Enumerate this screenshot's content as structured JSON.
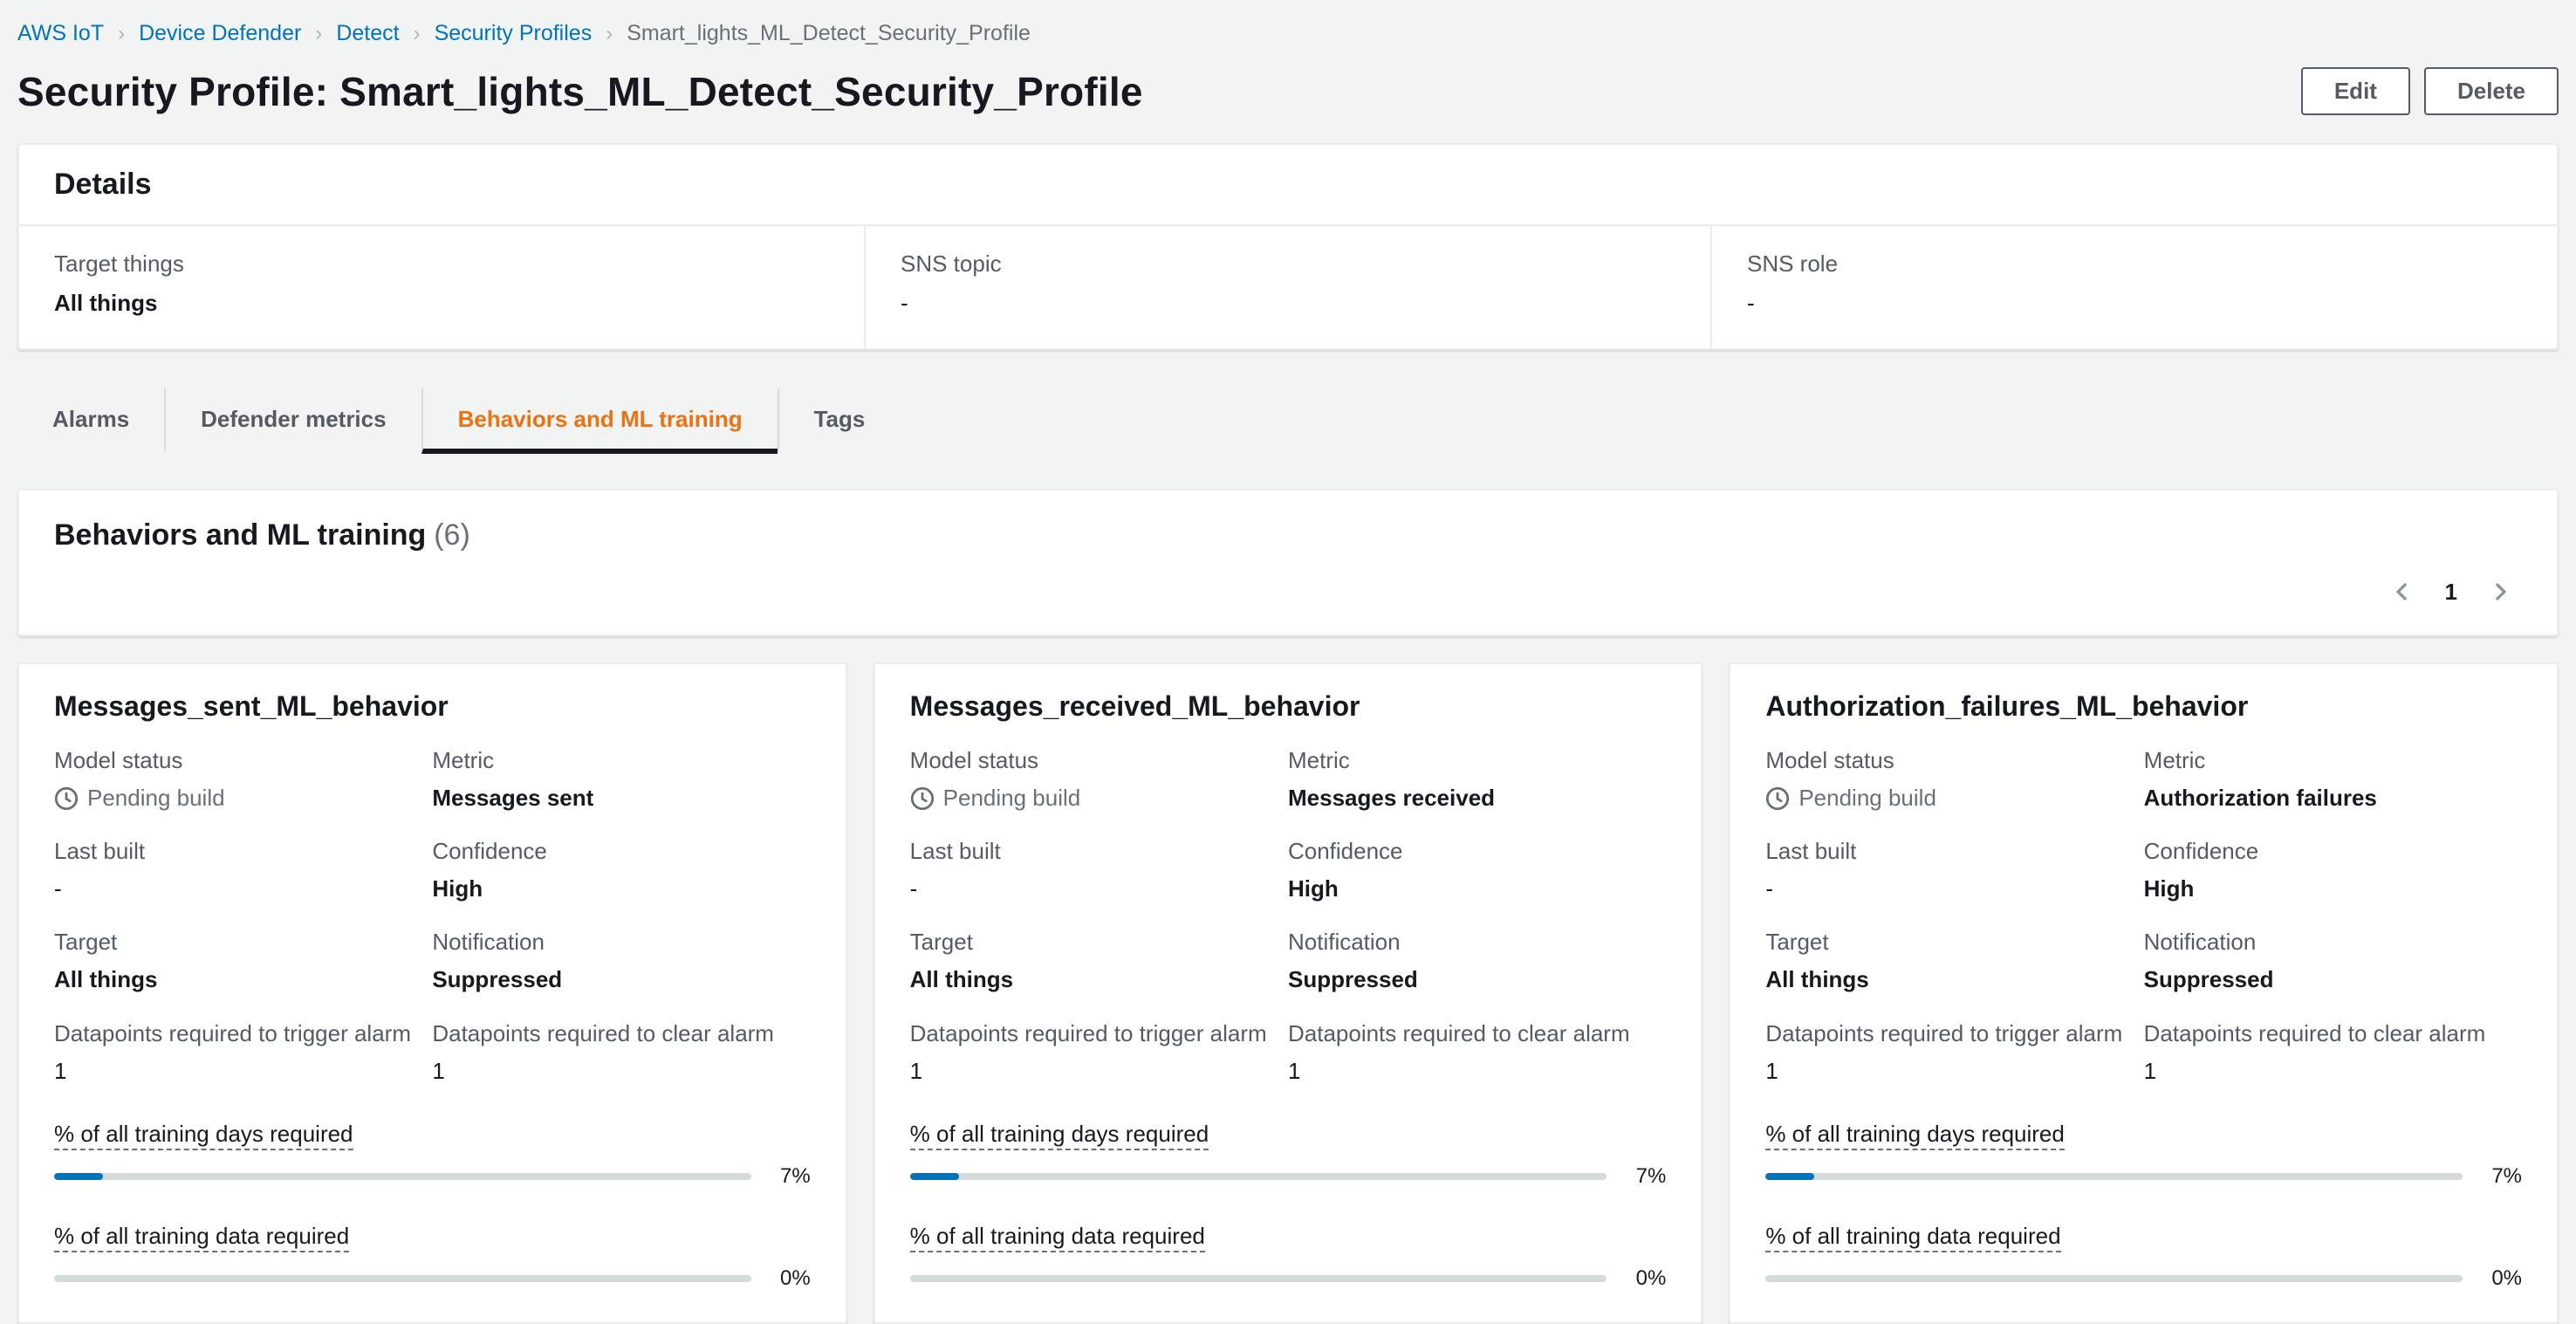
{
  "colors": {
    "accent_orange": "#ec7211",
    "link_blue": "#0073bb",
    "progress_blue": "#0073bb",
    "page_background": "#f2f3f3"
  },
  "breadcrumb": {
    "separator": "›",
    "items": [
      {
        "label": "AWS IoT"
      },
      {
        "label": "Device Defender"
      },
      {
        "label": "Detect"
      },
      {
        "label": "Security Profiles"
      },
      {
        "label": "Smart_lights_ML_Detect_Security_Profile"
      }
    ]
  },
  "header": {
    "title": "Security Profile: Smart_lights_ML_Detect_Security_Profile",
    "actions": {
      "edit": "Edit",
      "delete": "Delete"
    }
  },
  "details": {
    "title": "Details",
    "fields": [
      {
        "label": "Target things",
        "value": "All things"
      },
      {
        "label": "SNS topic",
        "value": "-"
      },
      {
        "label": "SNS role",
        "value": "-"
      }
    ]
  },
  "tabs": [
    {
      "label": "Alarms"
    },
    {
      "label": "Defender metrics"
    },
    {
      "label": "Behaviors and ML training"
    },
    {
      "label": "Tags"
    }
  ],
  "behaviors_section": {
    "title": "Behaviors and ML training",
    "count": "(6)",
    "page_number": "1"
  },
  "card_labels": {
    "model_status": "Model status",
    "metric": "Metric",
    "last_built": "Last built",
    "confidence": "Confidence",
    "target": "Target",
    "notification": "Notification",
    "datapoints_trigger": "Datapoints required to trigger alarm",
    "datapoints_clear": "Datapoints required to clear alarm",
    "training_days": "% of all training days required",
    "training_data": "% of all training data required"
  },
  "behavior_cards": [
    {
      "title": "Messages_sent_ML_behavior",
      "model_status": "Pending build",
      "metric": "Messages sent",
      "last_built": "-",
      "confidence": "High",
      "target": "All things",
      "notification": "Suppressed",
      "datapoints_to_trigger": "1",
      "datapoints_to_clear": "1",
      "training_days_percent": 7,
      "training_days_percent_label": "7%",
      "training_data_percent": 0,
      "training_data_percent_label": "0%"
    },
    {
      "title": "Messages_received_ML_behavior",
      "model_status": "Pending build",
      "metric": "Messages received",
      "last_built": "-",
      "confidence": "High",
      "target": "All things",
      "notification": "Suppressed",
      "datapoints_to_trigger": "1",
      "datapoints_to_clear": "1",
      "training_days_percent": 7,
      "training_days_percent_label": "7%",
      "training_data_percent": 0,
      "training_data_percent_label": "0%"
    },
    {
      "title": "Authorization_failures_ML_behavior",
      "model_status": "Pending build",
      "metric": "Authorization failures",
      "last_built": "-",
      "confidence": "High",
      "target": "All things",
      "notification": "Suppressed",
      "datapoints_to_trigger": "1",
      "datapoints_to_clear": "1",
      "training_days_percent": 7,
      "training_days_percent_label": "7%",
      "training_data_percent": 0,
      "training_data_percent_label": "0%"
    }
  ]
}
